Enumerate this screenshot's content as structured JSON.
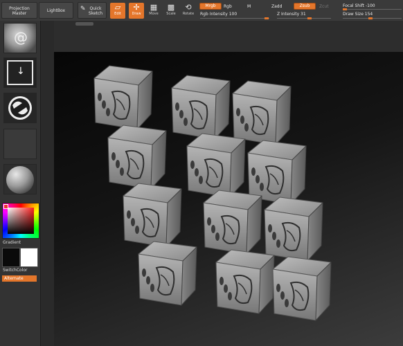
{
  "toolbar": {
    "projection_master": "Projection Master",
    "lightbox": "LightBox",
    "quick_sketch": "Quick Sketch",
    "edit": "Edit",
    "draw": "Draw",
    "move": "Move",
    "scale": "Scale",
    "rotate": "Rotate",
    "mrgb": "Mrgb",
    "rgb": "Rgb",
    "m": "M",
    "zadd": "Zadd",
    "zsub": "Zsub",
    "zcut": "Zcut",
    "rgb_intensity": "Rgb Intensity 100",
    "z_intensity": "Z Intensity 31",
    "focal_shift": "Focal Shift -100",
    "draw_size": "Draw Size 154"
  },
  "left_panel": {
    "gradient": "Gradient",
    "switch_color": "SwitchColor",
    "alternate": "Alternate"
  },
  "colors": {
    "accent": "#e4762b",
    "panel": "#333333",
    "die": "#9c9c9c"
  }
}
